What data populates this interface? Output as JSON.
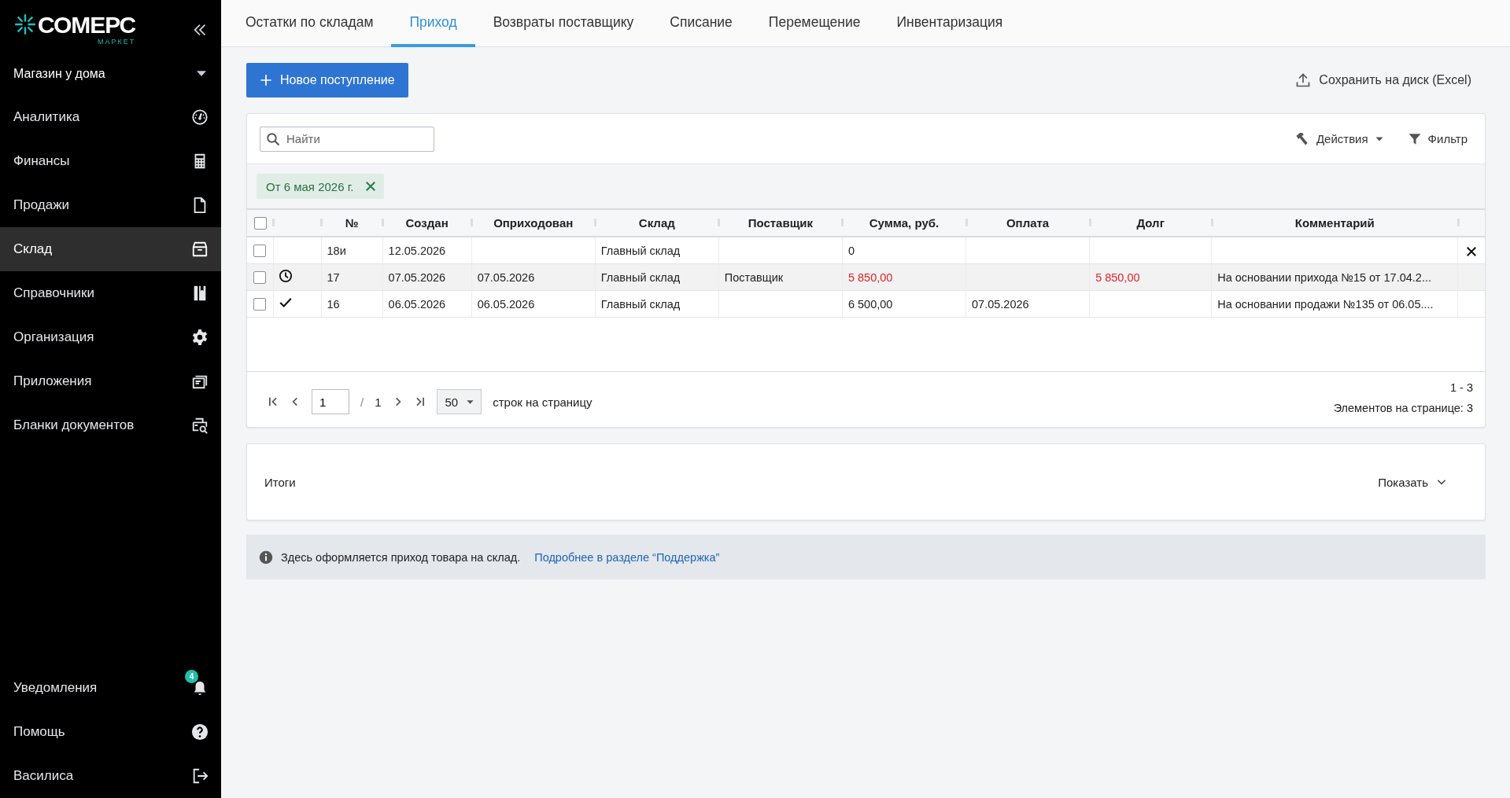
{
  "sidebar": {
    "logo": {
      "title": "СОМЕРС",
      "subtitle": "МАРКЕТ"
    },
    "store": {
      "label": "Магазин у дома"
    },
    "items": [
      {
        "label": "Аналитика",
        "selected": false
      },
      {
        "label": "Финансы",
        "selected": false
      },
      {
        "label": "Продажи",
        "selected": false
      },
      {
        "label": "Склад",
        "selected": true
      },
      {
        "label": "Справочники",
        "selected": false
      },
      {
        "label": "Организация",
        "selected": false
      },
      {
        "label": "Приложения",
        "selected": false
      },
      {
        "label": "Бланки документов",
        "selected": false
      }
    ],
    "bottom_items": [
      {
        "label": "Уведомления",
        "badge": "4"
      },
      {
        "label": "Помощь"
      },
      {
        "label": "Василиса"
      }
    ]
  },
  "tabs": [
    {
      "label": "Остатки по складам",
      "selected": false
    },
    {
      "label": "Приход",
      "selected": true
    },
    {
      "label": "Возвраты поставщику",
      "selected": false
    },
    {
      "label": "Списание",
      "selected": false
    },
    {
      "label": "Перемещение",
      "selected": false
    },
    {
      "label": "Инвентаризация",
      "selected": false
    }
  ],
  "toolbar": {
    "new_button": "Новое поступление",
    "export_button": "Сохранить на диск (Excel)"
  },
  "search": {
    "placeholder": "Найти"
  },
  "actions": {
    "label": "Действия"
  },
  "filter": {
    "label": "Фильтр"
  },
  "filter_chips": [
    {
      "label": "От 6 мая 2026 г."
    }
  ],
  "table": {
    "select_all": {
      "checked": false
    },
    "columns": [
      "№",
      "Создан",
      "Оприходован",
      "Склад",
      "Поставщик",
      "Сумма, руб.",
      "Оплата",
      "Долг",
      "Комментарий"
    ],
    "rows": [
      {
        "checked": false,
        "selected": false,
        "unpaid": false,
        "deletable": true,
        "cells": {
          "number": "18и",
          "created": "12.05.2026",
          "warehouse": "Главный склад",
          "sum": "0"
        }
      },
      {
        "checked": false,
        "selected": true,
        "unpaid": true,
        "deletable": false,
        "kind": "pending",
        "cells": {
          "number": "17",
          "created": "07.05.2026",
          "posted": "07.05.2026",
          "warehouse": "Главный склад",
          "supplier": "Поставщик",
          "sum": "5 850,00",
          "debt": "5 850,00",
          "comment": "На основании прихода №15 от 17.04.2..."
        }
      },
      {
        "checked": false,
        "selected": false,
        "unpaid": false,
        "deletable": false,
        "kind": "done",
        "cells": {
          "number": "16",
          "created": "06.05.2026",
          "posted": "06.05.2026",
          "warehouse": "Главный склад",
          "sum": "6 500,00",
          "payment": "07.05.2026",
          "comment": "На основании продажи №135 от 06.05...."
        }
      }
    ]
  },
  "pager": {
    "page": "1",
    "separator": "/",
    "total_pages": "1",
    "page_size": "50",
    "page_size_label": "строк на страницу",
    "range": "1 - 3",
    "count": "Элементов на странице: 3"
  },
  "totals": {
    "title": "Итоги",
    "toggle": "Показать"
  },
  "info": {
    "text": "Здесь оформляется приход товара на склад.",
    "link": "Подробнее в разделе “Поддержка”"
  }
}
